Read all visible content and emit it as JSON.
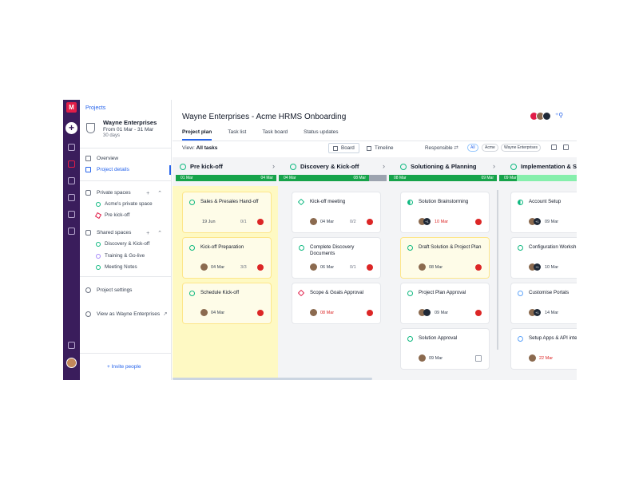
{
  "breadcrumb": "Projects",
  "project": {
    "name": "Wayne Enterprises",
    "dates": "From 01 Mar - 31 Mar",
    "duration": "30 days"
  },
  "sidebar": {
    "nav": [
      {
        "label": "Overview",
        "icon": "overview-icon"
      },
      {
        "label": "Project details",
        "icon": "send-icon"
      }
    ],
    "private_header": "Private spaces",
    "private_spaces": [
      "Acme's private space",
      "Pre kick-off"
    ],
    "shared_header": "Shared spaces",
    "shared_spaces": [
      "Discovery & Kick-off",
      "Training & Go-live",
      "Meeting Notes"
    ],
    "settings": "Project settings",
    "view_as": "View as Wayne Enterprises",
    "invite": "+ Invite people"
  },
  "header": {
    "title": "Wayne Enterprises - Acme HRMS Onboarding",
    "tabs": [
      "Project plan",
      "Task list",
      "Task board",
      "Status updates"
    ],
    "active_tab": "Project plan"
  },
  "toolbar": {
    "view_label": "View:",
    "view_value": "All tasks",
    "board": "Board",
    "timeline": "Timeline",
    "responsible": "Responsible",
    "filters": [
      "All",
      "Acme",
      "Wayne Enterprises"
    ]
  },
  "columns": [
    {
      "title": "Pre kick-off",
      "start": "01 Mar",
      "end": "04 Mar",
      "cards": [
        {
          "title": "Sales & Presales Hand-off",
          "date": "19 Jun",
          "count": "0/1",
          "status": "done"
        },
        {
          "title": "Kick-off Preparation",
          "date": "04 Mar",
          "count": "3/3",
          "status": "done"
        },
        {
          "title": "Schedule Kick-off",
          "date": "04 Mar",
          "count": "",
          "status": "done"
        }
      ]
    },
    {
      "title": "Discovery & Kick-off",
      "start": "04 Mar",
      "end": "08 Mar",
      "cards": [
        {
          "title": "Kick-off meeting",
          "date": "04 Mar",
          "count": "0/2",
          "status": "diamond"
        },
        {
          "title": "Complete Discovery Documents",
          "date": "06 Mar",
          "count": "0/1",
          "status": "done"
        },
        {
          "title": "Scope & Goals Approval",
          "date": "08 Mar",
          "count": "",
          "status": "diamond-red"
        }
      ]
    },
    {
      "title": "Solutioning & Planning",
      "start": "08 Mar",
      "end": "09 Mar",
      "cards": [
        {
          "title": "Solution Brainstorming",
          "date": "10 Mar",
          "count": "",
          "status": "half"
        },
        {
          "title": "Draft Solution & Project Plan",
          "date": "08 Mar",
          "count": "",
          "status": "done"
        },
        {
          "title": "Project Plan Approval",
          "date": "09 Mar",
          "count": "",
          "status": "done"
        },
        {
          "title": "Solution Approval",
          "date": "09 Mar",
          "count": "",
          "status": "done"
        }
      ]
    },
    {
      "title": "Implementation & Se",
      "start": "09 Mar",
      "end": "",
      "cards": [
        {
          "title": "Account Setup",
          "date": "09 Mar",
          "count": "",
          "status": "half"
        },
        {
          "title": "Configuration Worksh",
          "date": "10 Mar",
          "count": "",
          "status": "done"
        },
        {
          "title": "Customise Portals",
          "date": "14 Mar",
          "count": "",
          "status": "open"
        },
        {
          "title": "Setup Apps & API integrations",
          "date": "22 Mar",
          "count": "",
          "status": "open"
        }
      ]
    }
  ],
  "colors": {
    "rail": "#3a1d5c",
    "accent": "#2563eb",
    "timeline": "#16a34a",
    "lane": "#fef9c3"
  }
}
